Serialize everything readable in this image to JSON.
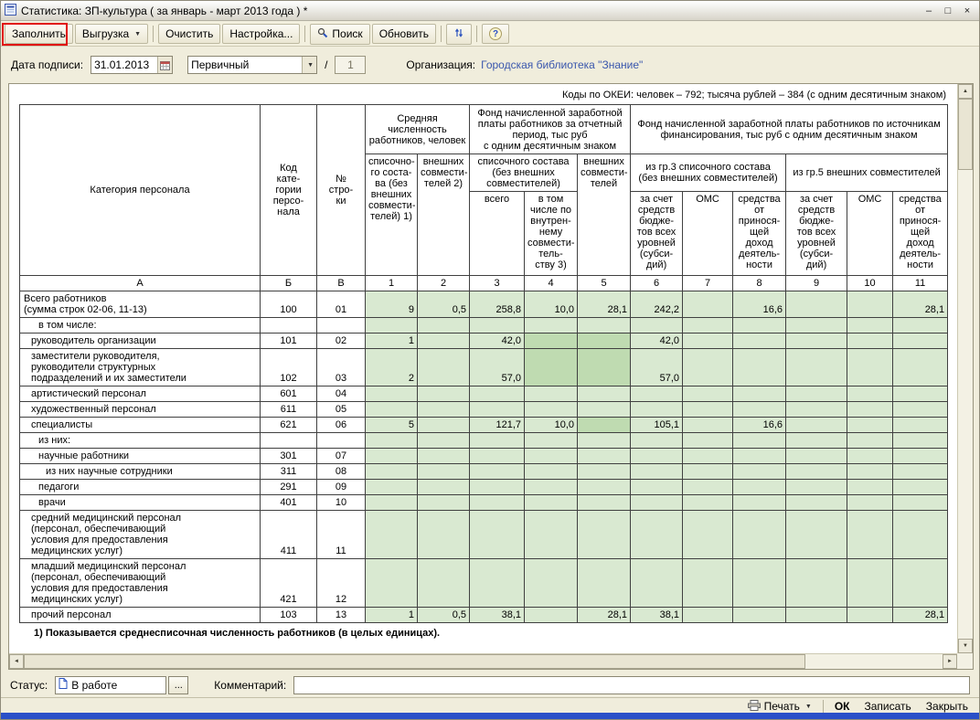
{
  "window": {
    "title": "Статистика: ЗП-культура ( за январь - март 2013 года ) *",
    "minimize": "–",
    "maximize": "□",
    "close": "×"
  },
  "icons": {
    "dropdown": "▼",
    "up": "▲",
    "down": "▼",
    "left": "◄",
    "right": "►",
    "help": "?"
  },
  "toolbar": {
    "fill": "Заполнить",
    "export": "Выгрузка",
    "clear": "Очистить",
    "settings": "Настройка...",
    "search": "Поиск",
    "refresh": "Обновить"
  },
  "form": {
    "date_label": "Дата подписи:",
    "date_value": "31.01.2013",
    "report_type": "Первичный",
    "slash": "/",
    "correction_number": "1",
    "org_label": "Организация:",
    "org_name": "Городская библиотека \"Знание\""
  },
  "table": {
    "okei_note": "Коды по ОКЕИ: человек – 792; тысяча рублей – 384 (с одним десятичным знаком)",
    "headers": {
      "category": "Категория персонала",
      "code": "Код\nкате-\nгории\nперсо-\nнала",
      "line": "№\nстро-\nки",
      "avg_count": "Средняя численность\nработников, человек",
      "fund_period": "Фонд начисленной заработной\nплаты работников за отчетный\nпериод, тыс руб\nс одним десятичным знаком",
      "fund_sources": "Фонд начисленной заработной платы работников по источникам\nфинансирования, тыс руб с одним десятичным знаком",
      "payroll_staff": "списочно-\nго соста-\nва (без\nвнешних\nсовмести-\nтелей) 1)",
      "external_2": "внешних\nсовмести-\nтелей 2)",
      "payroll_fund": "списочного состава\n(без внешних\nсовместителей)",
      "external_5": "внешних\nсовмести-\nтелей",
      "gr3": "из гр.3 списочного состава\n(без внешних совместителей)",
      "gr5": "из гр.5 внешних совместителей",
      "total": "всего",
      "internal": "в том\nчисле по\nвнутрен-\nнему\nсовмести-\nтель-\nству 3)",
      "budget": "за счет\nсредств\nбюдже-\nтов всех\nуровней\n(субси-\nдий)",
      "oms": "ОМС",
      "income": "средства\nот\nпринося-\nщей доход\nдеятель-\nности"
    },
    "letters": [
      "А",
      "Б",
      "В",
      "1",
      "2",
      "3",
      "4",
      "5",
      "6",
      "7",
      "8",
      "9",
      "10",
      "11"
    ],
    "rows": [
      {
        "label": "Всего работников\n(сумма строк 02-06, 11-13)",
        "indent": 0,
        "code": "100",
        "line": "01",
        "values": [
          "9",
          "0,5",
          "258,8",
          "10,0",
          "28,1",
          "242,2",
          "",
          "16,6",
          "",
          "",
          "28,1"
        ]
      },
      {
        "label": "в том числе:",
        "indent": 2,
        "code": "",
        "line": "",
        "values": [
          "",
          "",
          "",
          "",
          "",
          "",
          "",
          "",
          "",
          "",
          ""
        ]
      },
      {
        "label": "руководитель организации",
        "indent": 1,
        "code": "101",
        "line": "02",
        "values": [
          "1",
          "",
          "42,0",
          "",
          "",
          "42,0",
          "",
          "",
          "",
          "",
          ""
        ],
        "dark": [
          3,
          4
        ]
      },
      {
        "label": "заместители руководителя,\nруководители структурных\nподразделений и их заместители",
        "indent": 1,
        "code": "102",
        "line": "03",
        "values": [
          "2",
          "",
          "57,0",
          "",
          "",
          "57,0",
          "",
          "",
          "",
          "",
          ""
        ],
        "dark": [
          3,
          4
        ]
      },
      {
        "label": "артистический персонал",
        "indent": 1,
        "code": "601",
        "line": "04",
        "values": [
          "",
          "",
          "",
          "",
          "",
          "",
          "",
          "",
          "",
          "",
          ""
        ]
      },
      {
        "label": "художественный персонал",
        "indent": 1,
        "code": "611",
        "line": "05",
        "values": [
          "",
          "",
          "",
          "",
          "",
          "",
          "",
          "",
          "",
          "",
          ""
        ]
      },
      {
        "label": "специалисты",
        "indent": 1,
        "code": "621",
        "line": "06",
        "values": [
          "5",
          "",
          "121,7",
          "10,0",
          "",
          "105,1",
          "",
          "16,6",
          "",
          "",
          ""
        ],
        "dark": [
          4
        ]
      },
      {
        "label": "из них:",
        "indent": 2,
        "code": "",
        "line": "",
        "values": [
          "",
          "",
          "",
          "",
          "",
          "",
          "",
          "",
          "",
          "",
          ""
        ]
      },
      {
        "label": "научные работники",
        "indent": 2,
        "code": "301",
        "line": "07",
        "values": [
          "",
          "",
          "",
          "",
          "",
          "",
          "",
          "",
          "",
          "",
          ""
        ]
      },
      {
        "label": "из них научные сотрудники",
        "indent": 3,
        "code": "311",
        "line": "08",
        "values": [
          "",
          "",
          "",
          "",
          "",
          "",
          "",
          "",
          "",
          "",
          ""
        ]
      },
      {
        "label": "педагоги",
        "indent": 2,
        "code": "291",
        "line": "09",
        "values": [
          "",
          "",
          "",
          "",
          "",
          "",
          "",
          "",
          "",
          "",
          ""
        ]
      },
      {
        "label": "врачи",
        "indent": 2,
        "code": "401",
        "line": "10",
        "values": [
          "",
          "",
          "",
          "",
          "",
          "",
          "",
          "",
          "",
          "",
          ""
        ]
      },
      {
        "label": "средний медицинский персонал\n(персонал, обеспечивающий\nусловия для предоставления\nмедицинских услуг)",
        "indent": 1,
        "code": "411",
        "line": "11",
        "values": [
          "",
          "",
          "",
          "",
          "",
          "",
          "",
          "",
          "",
          "",
          ""
        ]
      },
      {
        "label": "младший медицинский персонал\n(персонал, обеспечивающий\nусловия для предоставления\nмедицинских услуг)",
        "indent": 1,
        "code": "421",
        "line": "12",
        "values": [
          "",
          "",
          "",
          "",
          "",
          "",
          "",
          "",
          "",
          "",
          ""
        ]
      },
      {
        "label": "прочий персонал",
        "indent": 1,
        "code": "103",
        "line": "13",
        "values": [
          "1",
          "0,5",
          "38,1",
          "",
          "28,1",
          "38,1",
          "",
          "",
          "",
          "",
          "28,1"
        ]
      }
    ],
    "footnote": "1) Показывается среднесписочная численность работников (в целых единицах)."
  },
  "status": {
    "label": "Статус:",
    "value": "В работе",
    "more_button": "...",
    "comment_label": "Комментарий:"
  },
  "footer": {
    "print": "Печать",
    "ok": "ОК",
    "save": "Записать",
    "close": "Закрыть"
  },
  "colors": {
    "cell_green": "#d9e9d1",
    "cell_green_dark": "#bfdbb1",
    "link_blue": "#3a57ad",
    "highlight_red": "#e01010"
  }
}
